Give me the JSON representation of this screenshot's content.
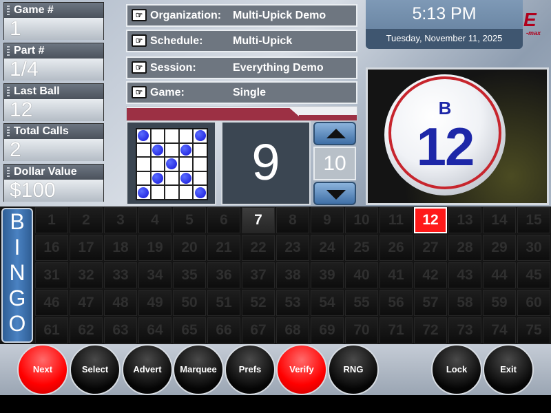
{
  "stats": {
    "game": {
      "label": "Game #",
      "value": "1"
    },
    "part": {
      "label": "Part #",
      "value": "1/4"
    },
    "last_ball": {
      "label": "Last Ball",
      "value": "12"
    },
    "total_calls": {
      "label": "Total Calls",
      "value": "2"
    },
    "dollar_value": {
      "label": "Dollar Value",
      "value": "$100"
    }
  },
  "info": {
    "organization": {
      "label": "Organization:",
      "value": "Multi-Upick Demo"
    },
    "schedule": {
      "label": "Schedule:",
      "value": "Multi-Upick"
    },
    "session": {
      "label": "Session:",
      "value": "Everything Demo"
    },
    "game": {
      "label": "Game:",
      "value": "Single"
    }
  },
  "clock": {
    "time": "5:13 PM",
    "date": "Tuesday, November 11, 2025"
  },
  "logo": {
    "text": "E",
    "sub": "-max"
  },
  "current_ball": {
    "letter": "B",
    "number": "12"
  },
  "pattern": {
    "cells": [
      1,
      0,
      0,
      0,
      1,
      0,
      1,
      0,
      1,
      0,
      0,
      0,
      1,
      0,
      0,
      0,
      1,
      0,
      1,
      0,
      1,
      0,
      0,
      0,
      1
    ],
    "number": "9"
  },
  "speed": {
    "value": "10"
  },
  "board": {
    "letters": [
      "B",
      "I",
      "N",
      "G",
      "O"
    ],
    "called": [
      7
    ],
    "current": 12
  },
  "buttons": [
    {
      "label": "Next",
      "style": "red"
    },
    {
      "label": "Select",
      "style": "black"
    },
    {
      "label": "Advert",
      "style": "black"
    },
    {
      "label": "Marquee",
      "style": "black"
    },
    {
      "label": "Prefs",
      "style": "black"
    },
    {
      "label": "Verify",
      "style": "red"
    },
    {
      "label": "RNG",
      "style": "black"
    },
    {
      "label": "Lock",
      "style": "black"
    },
    {
      "label": "Exit",
      "style": "black"
    }
  ],
  "colors": {
    "accent": "#ff1a1a",
    "bingo_blue": "#3f74b5",
    "tab_red": "#9c3044"
  }
}
